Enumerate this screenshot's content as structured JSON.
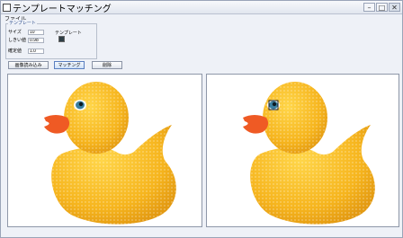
{
  "window": {
    "title": "テンプレートマッチング"
  },
  "menu": {
    "items": [
      "ファイル"
    ]
  },
  "template_group": {
    "label": "テンプレート",
    "fields": [
      {
        "label": "サイズ",
        "value": "10"
      },
      {
        "label": "しきい値",
        "value": "0.98"
      },
      {
        "label": "確定値",
        "value": "1.0"
      }
    ],
    "template_label": "テンプレート",
    "template_color": "#2e3e45"
  },
  "buttons": {
    "load": "画像読み込み",
    "match": "マッチング",
    "clear": "削除"
  },
  "panels": {
    "left": {
      "image": "rubber-duck"
    },
    "right": {
      "image": "rubber-duck-matched"
    }
  },
  "colors": {
    "duck_body": "#f6b51e",
    "duck_beak": "#ef5a24",
    "accent": "#5a7fc0"
  }
}
